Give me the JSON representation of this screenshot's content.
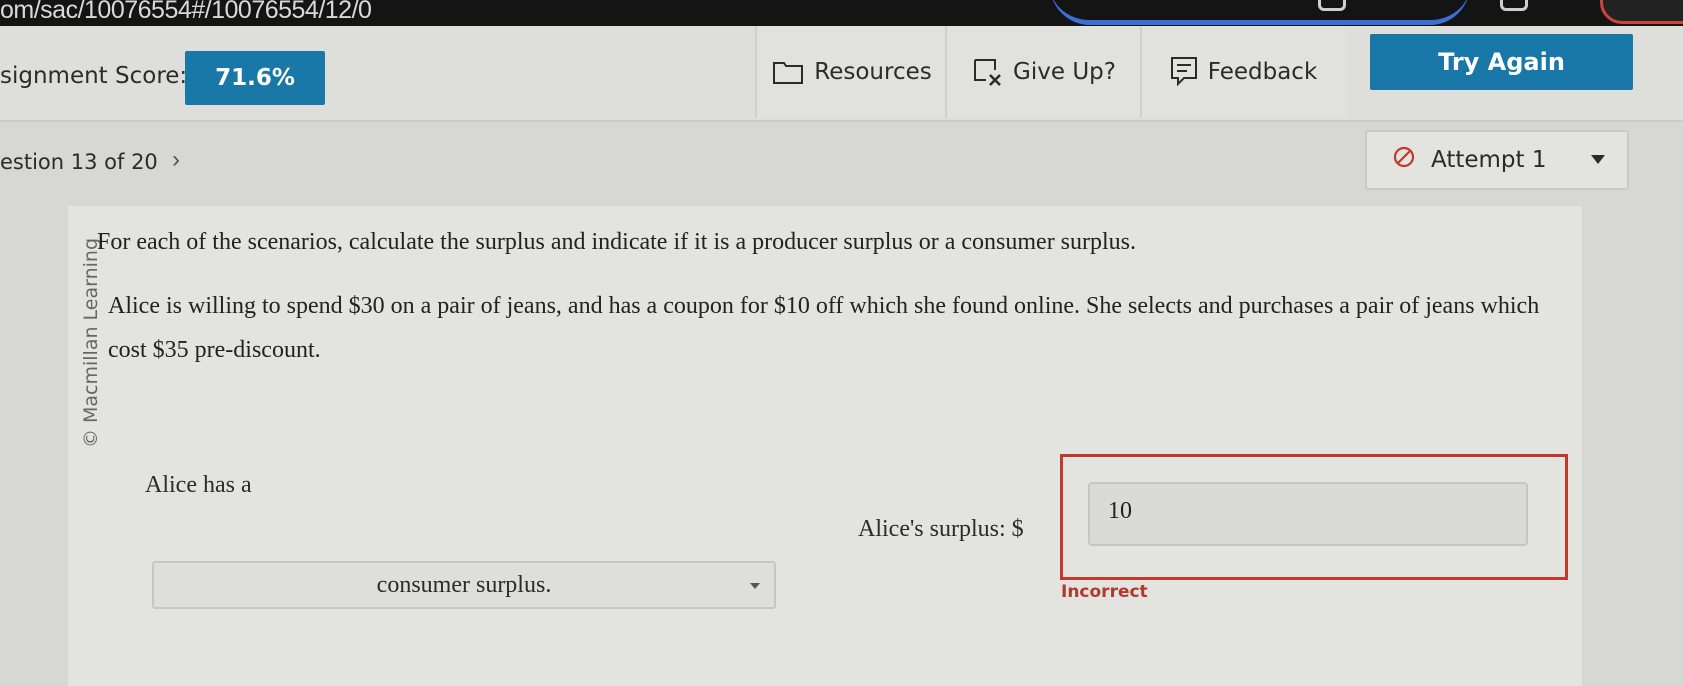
{
  "browser": {
    "url_fragment": "om/sac/10076554#/10076554/12/0"
  },
  "header": {
    "score_label": "signment Score:",
    "score_value": "71.6%",
    "resources_label": "Resources",
    "give_up_label": "Give Up?",
    "feedback_label": "Feedback",
    "try_again_label": "Try Again"
  },
  "question_nav": {
    "position_label": "estion 13 of 20",
    "attempt_label": "Attempt 1"
  },
  "question": {
    "copyright": "© Macmillan Learning",
    "prompt": "For each of the scenarios, calculate the surplus and indicate if it is a producer surplus or a consumer surplus.",
    "scenario": "Alice is willing to spend $30 on a pair of jeans, and has a coupon for $10 off which she found online. She selects and purchases a pair of jeans which cost $35 pre-discount.",
    "alice_has_label": "Alice has a",
    "surplus_type_selected": "consumer surplus.",
    "surplus_label": "Alice's surplus: $",
    "surplus_value": "10",
    "feedback_status": "Incorrect"
  },
  "colors": {
    "accent": "#1a78a8",
    "error": "#c0392b"
  }
}
